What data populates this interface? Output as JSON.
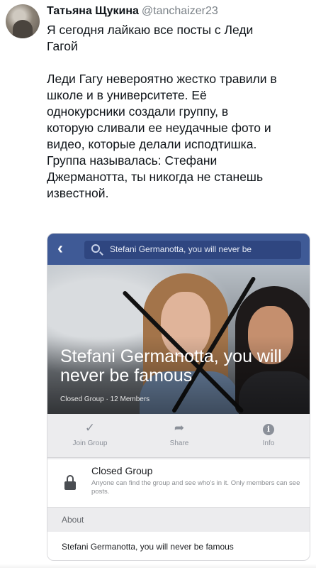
{
  "tweet": {
    "author_name": "Татьяна Щукина",
    "author_handle": "@tanchaizer23",
    "paragraph1": "Я сегодня лайкаю все посты с Леди\nГагой",
    "paragraph2": "Леди Гагу невероятно жестко травили в\nшколе и в университете. Её\nоднокурсники создали группу, в\nкоторую сливали ее неудачные фото и\nвидео, которые делали исподтишка.\nГруппа называлась:  Стефани\nДжерманотта, ты никогда не станешь\nизвестной."
  },
  "embed": {
    "search_text": "Stefani Germanotta, you will never be",
    "group_name": "Stefani Germanotta, you will never be famous",
    "group_meta": "Closed Group · 12 Members",
    "actions": {
      "join": "Join Group",
      "share": "Share",
      "info": "Info"
    },
    "closed_title": "Closed Group",
    "closed_desc": "Anyone can find the group and see who's in it. Only members can see posts.",
    "about_label": "About",
    "about_text": "Stefani Germanotta, you will never be famous",
    "accent_color": "#3f5a96",
    "icons": [
      "back-arrow-icon",
      "search-icon",
      "checkmark-icon",
      "share-arrow-icon",
      "info-icon",
      "lock-icon"
    ]
  }
}
